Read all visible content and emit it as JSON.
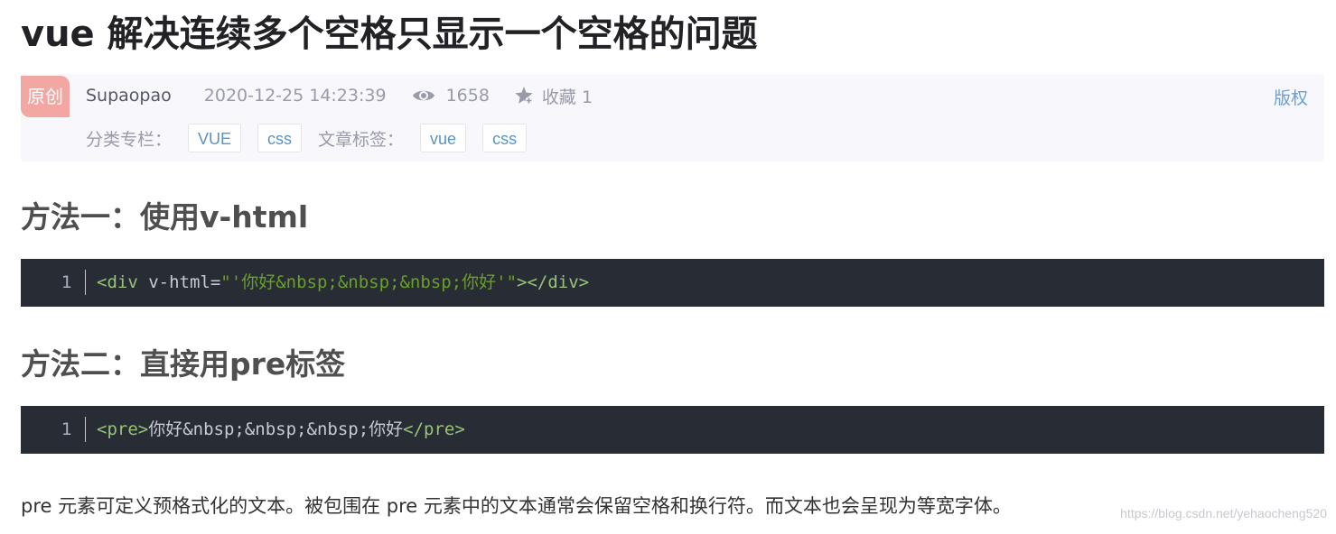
{
  "article": {
    "title": "vue 解决连续多个空格只显示一个空格的问题"
  },
  "meta": {
    "original_badge": "原创",
    "author": "Supaopao",
    "date": "2020-12-25 14:23:39",
    "views": "1658",
    "favorites": "收藏 1",
    "copyright": "版权",
    "category_label": "分类专栏：",
    "categories": [
      "VUE",
      "css"
    ],
    "tags_label": "文章标签：",
    "tags": [
      "vue",
      "css"
    ],
    "icons": {
      "views": "eye-icon",
      "favorites": "star-icon"
    },
    "colors": {
      "badge_bg": "#f2a7a3",
      "link": "#6b9fd3",
      "tag_text": "#5893c2"
    }
  },
  "sections": [
    {
      "heading": "方法一：使用v-html",
      "code": {
        "line_number": "1",
        "tokens": {
          "open": "<div",
          "attr": " v-html",
          "eq": "=",
          "value_q1": "\"'",
          "text1": "你好",
          "ent1": "&nbsp;",
          "ent2": "&nbsp;",
          "ent3": "&nbsp;",
          "semi": ";",
          "text2": "你好",
          "value_q2": "'\"",
          "close1": "></div>"
        }
      }
    },
    {
      "heading": "方法二：直接用pre标签",
      "code": {
        "line_number": "1",
        "tokens": {
          "open": "<pre>",
          "text1": "你好",
          "ent1": "&nbsp;",
          "ent2": "&nbsp;",
          "ent3": "&nbsp;",
          "text2": "你好",
          "close": "</pre>"
        }
      }
    }
  ],
  "paragraph": "pre 元素可定义预格式化的文本。被包围在 pre 元素中的文本通常会保留空格和换行符。而文本也会呈现为等宽字体。",
  "watermark": "https://blog.csdn.net/yehaocheng520",
  "theme": {
    "code_bg": "#282c34",
    "code_tag": "#98c379",
    "code_string": "#6a9f2a"
  }
}
